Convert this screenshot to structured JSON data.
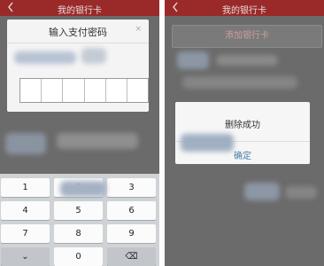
{
  "left": {
    "header": {
      "title": "我的银行卡"
    },
    "dialog": {
      "title": "输入支付密码",
      "close_icon": "×",
      "pin_length": 6
    },
    "keypad": {
      "keys": [
        "1",
        "2",
        "3",
        "4",
        "5",
        "6",
        "7",
        "8",
        "9",
        "⌄",
        "0",
        "⌫"
      ]
    }
  },
  "right": {
    "header": {
      "title": "我的银行卡"
    },
    "add_card_label": "添加银行卡",
    "dialog": {
      "message": "删除成功",
      "confirm_label": "确定"
    }
  },
  "colors": {
    "header_bg": "#9a2a2a",
    "overlay_bg": "#6b6b6b",
    "confirm_text": "#4a7ca8"
  }
}
